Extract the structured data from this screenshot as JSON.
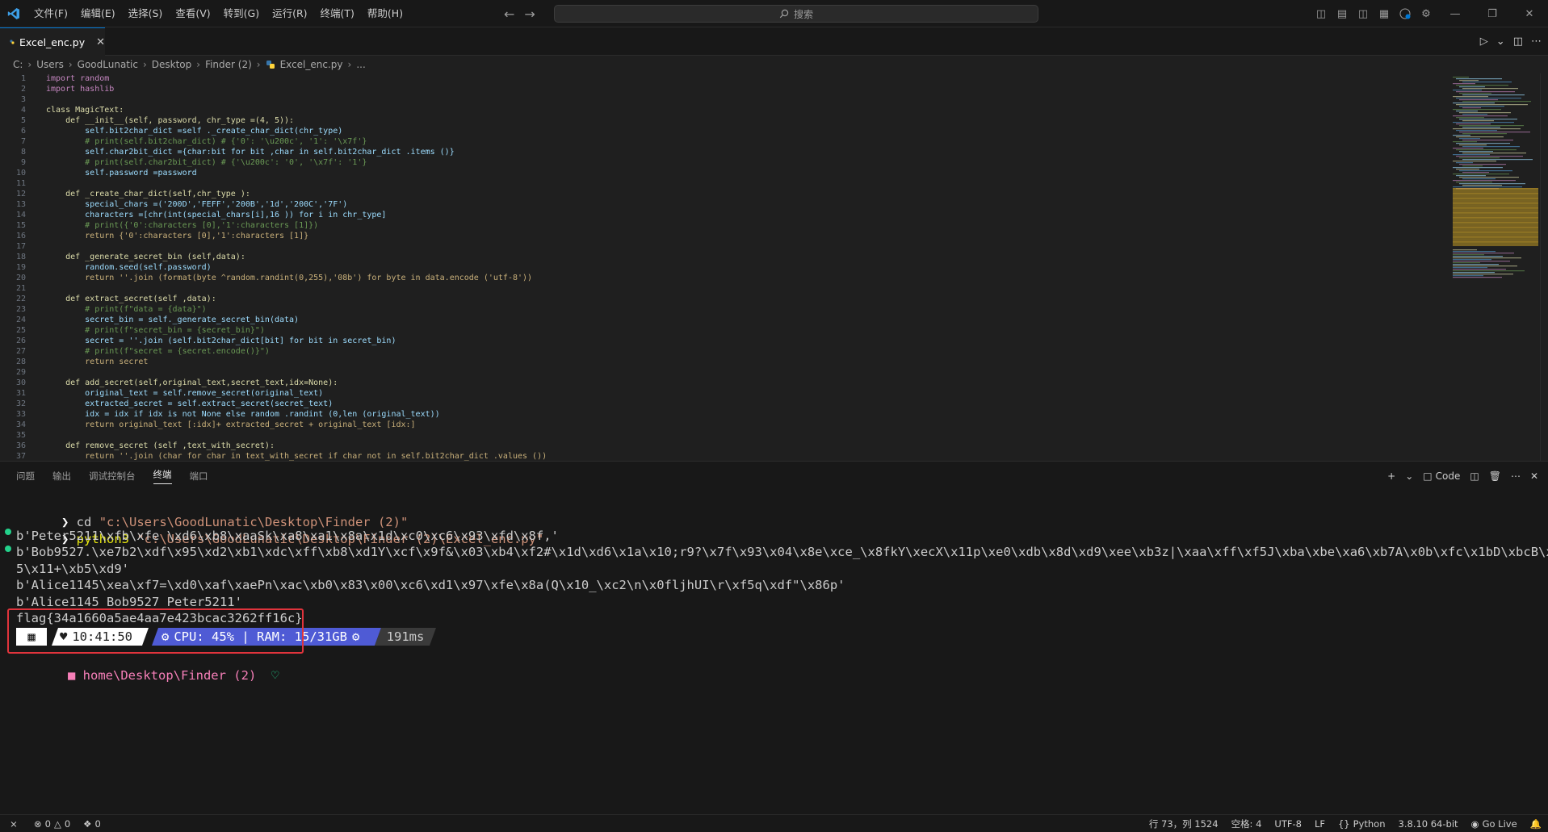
{
  "titlebar": {
    "menu": [
      "文件(F)",
      "编辑(E)",
      "选择(S)",
      "查看(V)",
      "转到(G)",
      "运行(R)",
      "终端(T)",
      "帮助(H)"
    ],
    "search_label": "搜索"
  },
  "tab": {
    "filename": "Excel_enc.py"
  },
  "breadcrumb": [
    "C:",
    "Users",
    "GoodLunatic",
    "Desktop",
    "Finder (2)",
    "Excel_enc.py",
    "..."
  ],
  "editor": {
    "line_numbers": [
      "1",
      "2",
      "3",
      "4",
      "5",
      "6",
      "7",
      "8",
      "9",
      "10",
      "11",
      "12",
      "13",
      "14",
      "15",
      "16",
      "17",
      "18",
      "19",
      "20",
      "21",
      "22",
      "23",
      "24",
      "25",
      "26",
      "27",
      "28",
      "29",
      "30",
      "31",
      "32",
      "33",
      "34",
      "35",
      "36",
      "37"
    ],
    "lines": [
      "import random",
      "import hashlib",
      "",
      "class MagicText:",
      "    def __init__(self, password, chr_type =(4, 5)):",
      "        self.bit2char_dict =self ._create_char_dict(chr_type)",
      "        # print(self.bit2char_dict) # {'0': '\\u200c', '1': '\\x7f'}",
      "        self.char2bit_dict ={char:bit for bit ,char in self.bit2char_dict .items ()}",
      "        # print(self.char2bit_dict) # {'\\u200c': '0', '\\x7f': '1'}",
      "        self.password =password",
      "",
      "    def _create_char_dict(self,chr_type ):",
      "        special_chars =('200D','FEFF','200B','1d','200C','7F')",
      "        characters =[chr(int(special_chars[i],16 )) for i in chr_type]",
      "        # print({'0':characters [0],'1':characters [1]})",
      "        return {'0':characters [0],'1':characters [1]}",
      "",
      "    def _generate_secret_bin (self,data):",
      "        random.seed(self.password)",
      "        return ''.join (format(byte ^random.randint(0,255),'08b') for byte in data.encode ('utf-8'))",
      "",
      "    def extract_secret(self ,data):",
      "        # print(f\"data = {data}\")",
      "        secret_bin = self._generate_secret_bin(data)",
      "        # print(f\"secret_bin = {secret_bin}\")",
      "        secret = ''.join (self.bit2char_dict[bit] for bit in secret_bin)",
      "        # print(f\"secret = {secret.encode()}\")",
      "        return secret",
      "",
      "    def add_secret(self,original_text,secret_text,idx=None):",
      "        original_text = self.remove_secret(original_text)",
      "        extracted_secret = self.extract_secret(secret_text)",
      "        idx = idx if idx is not None else random .randint (0,len (original_text))",
      "        return original_text [:idx]+ extracted_secret + original_text [idx:]",
      "",
      "    def remove_secret (self ,text_with_secret):",
      "        return ''.join (char for char in text_with_secret if char not in self.bit2char_dict .values ())"
    ]
  },
  "panel": {
    "tabs": [
      "问题",
      "输出",
      "调试控制台",
      "终端",
      "端口"
    ],
    "active_tab": "终端",
    "code_label": "Code"
  },
  "terminal": {
    "cmd1_prefix": "cd",
    "cmd1_arg": "\"c:\\Users\\GoodLunatic\\Desktop\\Finder (2)\"",
    "cmd2_prefix": "python3",
    "cmd2_arg": "\"c:\\Users\\GoodLunatic\\Desktop\\Finder (2)\\Excel_enc.py\"",
    "out1": "b'Peter5211\\xfb\\xfe \\xd6\\xb8\\xaaSk\\xa8\\xa1\\x8a\\x1d\\xc0\\xc6\\x93\\xfd\\x8f,'",
    "out2a": "b'Bob9527.\\xe7b2\\xdf\\x95\\xd2\\xb1\\xdc\\xff\\xb8\\xd1Y\\xcf\\x9f&\\x03\\xb4\\xf2#\\x1d\\xd6\\x1a\\x10;r9?\\x7f\\x93\\x04\\x8e\\xce_\\x8fkY\\xecX\\x11p\\xe0\\xdb\\x8d\\xd9\\xee\\xb3z|\\xaa\\xff\\xf5J\\xba\\xbe\\xa6\\xb7A\\x0b\\xfc\\x1bD\\xbcB\\xcd\\xe",
    "out2b": "5\\x11+\\xb5\\xd9'",
    "out3": "b'Alice1145\\xea\\xf7=\\xd0\\xaf\\xaePn\\xac\\xb0\\x83\\x00\\xc6\\xd1\\x97\\xfe\\x8a(Q\\x10_\\xc2\\n\\x0fljhUI\\r\\xf5q\\xdf\"\\x86p'",
    "out4": "b'Alice1145_Bob9527_Peter5211'",
    "flag": "flag{34a1660a5ae4aa7e423bcac3262ff16c}",
    "prompt_time": "10:41:50",
    "prompt_cpu": "CPU: 45% | RAM: 15/31GB",
    "prompt_duration": "191ms",
    "prompt_path": "home\\Desktop\\Finder (2)"
  },
  "statusbar": {
    "errors": "0",
    "warnings": "0",
    "ports": "0",
    "position": "行 73，列 1524",
    "spaces": "空格: 4",
    "encoding": "UTF-8",
    "eol": "LF",
    "language": "Python",
    "interpreter": "3.8.10 64-bit",
    "golive": "Go Live"
  },
  "colors": {
    "accent": "#0078d4",
    "terminal_green": "#23d18b",
    "highlight_red": "#e0343c",
    "prompt_white": "#ffffff",
    "prompt_blue": "#4f5bd5",
    "prompt_gray": "#3a3a3a"
  }
}
